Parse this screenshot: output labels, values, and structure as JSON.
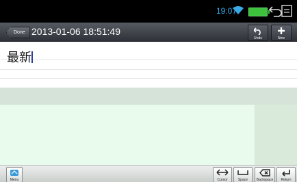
{
  "status_bar": {
    "time": "19:07"
  },
  "toolbar": {
    "done_label": "Done",
    "title": "2013-01-06 18:51:49",
    "undo_label": "Undo",
    "new_label": "New"
  },
  "editor": {
    "text": "最新"
  },
  "bottom_bar": {
    "menu_label": "Menu",
    "cursor_label": "Cursor",
    "space_label": "Space",
    "backspace_label": "Backspace",
    "return_label": "Return"
  },
  "colors": {
    "accent_time": "#38a9e6",
    "battery": "#3ec23e",
    "band": "#d6e3d9",
    "panel": "#e8fbec"
  },
  "icons": [
    "wifi-icon",
    "battery-icon",
    "back-icon",
    "recent-apps-icon",
    "undo-icon",
    "plus-icon",
    "menu-icon",
    "cursor-arrows-icon",
    "space-icon",
    "backspace-icon",
    "return-icon"
  ]
}
